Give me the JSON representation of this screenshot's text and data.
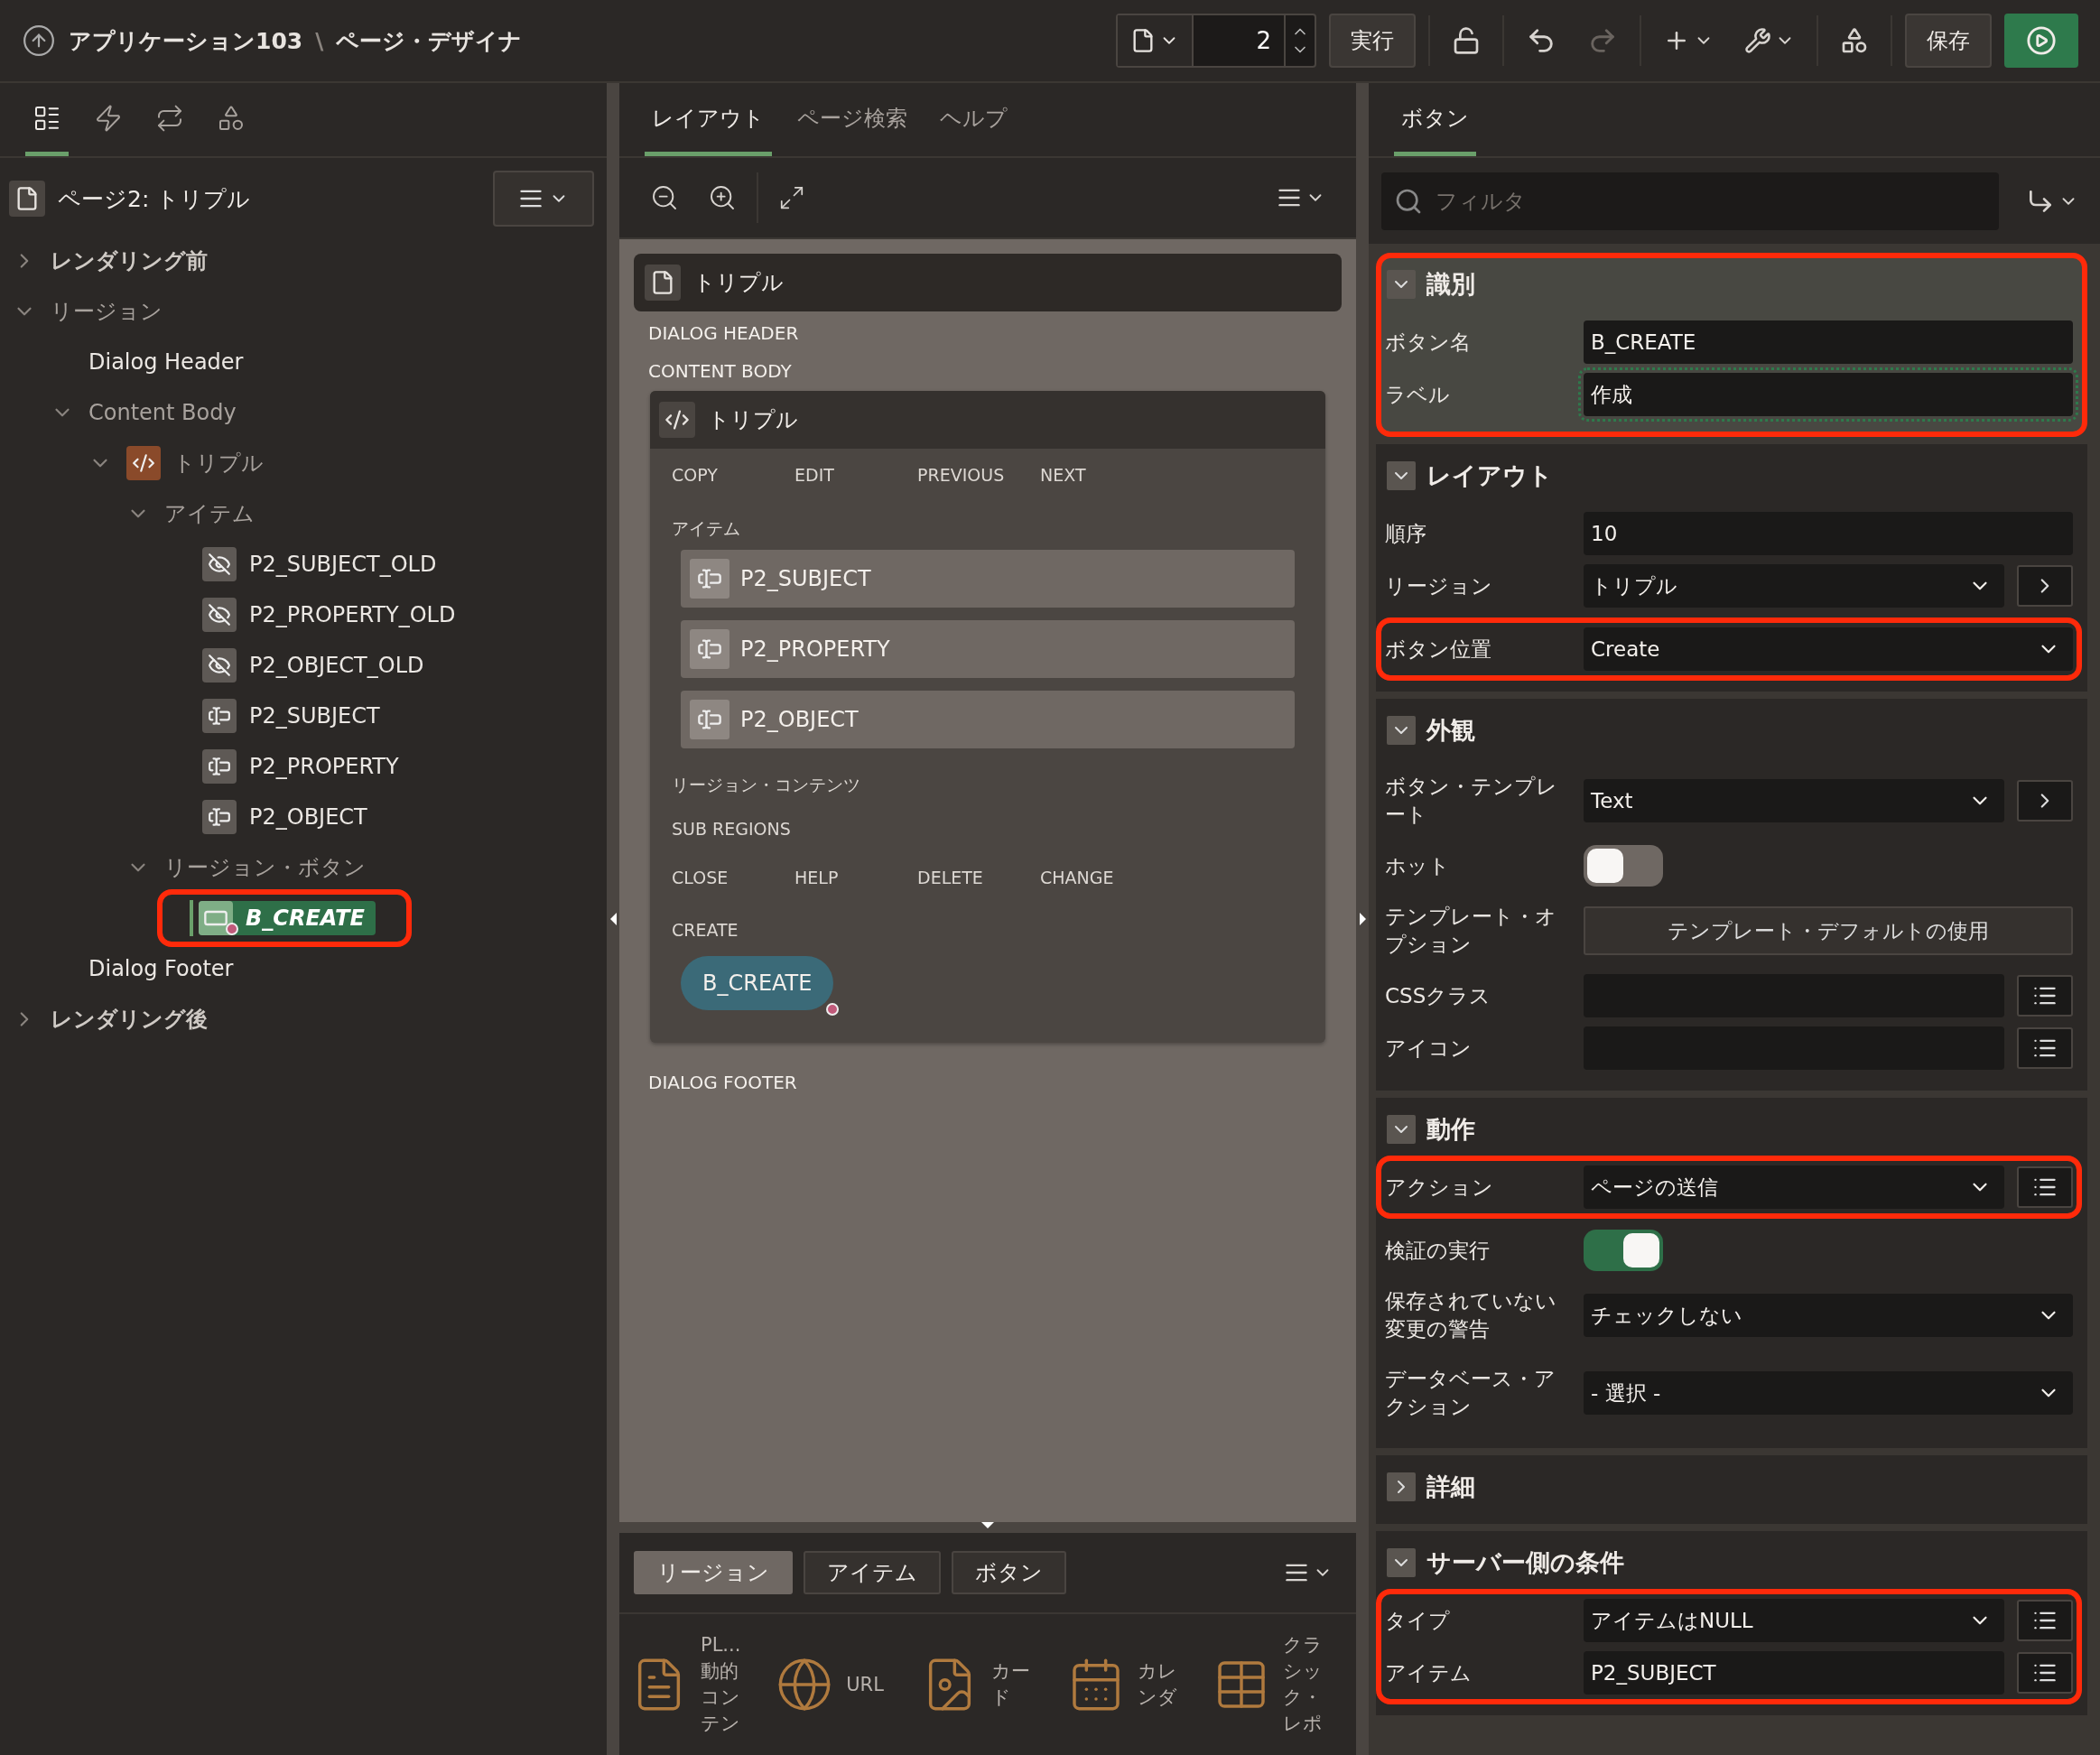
{
  "header": {
    "app": "アプリケーション103",
    "separator": "\\",
    "page_title": "ページ・デザイナ",
    "page_number": "2",
    "run_label": "実行",
    "redo_disabled": true,
    "save_label": "保存"
  },
  "left_tabs": [
    {
      "kind": "tree",
      "selected": true
    },
    {
      "kind": "dynamic",
      "selected": false
    },
    {
      "kind": "process",
      "selected": false
    },
    {
      "kind": "shared",
      "selected": false
    }
  ],
  "tree": {
    "root": "ページ2: トリプル",
    "nodes": [
      {
        "label": "レンダリング前",
        "bold": true,
        "expanded": false
      },
      {
        "label": "リージョン",
        "bold": false,
        "expanded": true,
        "children": [
          {
            "label": "Dialog Header"
          },
          {
            "label": "Content Body",
            "expanded": true,
            "children": [
              {
                "label": "トリプル",
                "kind": "region",
                "expanded": true,
                "children": [
                  {
                    "label": "アイテム",
                    "expanded": true,
                    "children": [
                      {
                        "label": "P2_SUBJECT_OLD",
                        "kind": "hidden"
                      },
                      {
                        "label": "P2_PROPERTY_OLD",
                        "kind": "hidden"
                      },
                      {
                        "label": "P2_OBJECT_OLD",
                        "kind": "hidden"
                      },
                      {
                        "label": "P2_SUBJECT",
                        "kind": "text"
                      },
                      {
                        "label": "P2_PROPERTY",
                        "kind": "text"
                      },
                      {
                        "label": "P2_OBJECT",
                        "kind": "text"
                      }
                    ]
                  },
                  {
                    "label": "リージョン・ボタン",
                    "expanded": true,
                    "children": [
                      {
                        "label": "B_CREATE",
                        "kind": "button",
                        "selected": true,
                        "highlighted": true,
                        "condition": true
                      }
                    ]
                  }
                ]
              }
            ]
          },
          {
            "label": "Dialog Footer"
          }
        ]
      },
      {
        "label": "レンダリング後",
        "bold": true,
        "expanded": false
      }
    ]
  },
  "middle_tabs": [
    {
      "label": "レイアウト",
      "selected": true
    },
    {
      "label": "ページ検索",
      "selected": false
    },
    {
      "label": "ヘルプ",
      "selected": false
    }
  ],
  "canvas": {
    "page": "トリプル",
    "dialog_header": "DIALOG HEADER",
    "content_body": "CONTENT BODY",
    "region": {
      "title": "トリプル",
      "top_positions": [
        "COPY",
        "EDIT",
        "PREVIOUS",
        "NEXT"
      ],
      "items_label": "アイテム",
      "items": [
        "P2_SUBJECT",
        "P2_PROPERTY",
        "P2_OBJECT"
      ],
      "region_content": "リージョン・コンテンツ",
      "sub_regions": "SUB REGIONS",
      "bottom_positions": [
        "CLOSE",
        "HELP",
        "DELETE",
        "CHANGE"
      ],
      "create_label": "CREATE",
      "button": {
        "label": "B_CREATE",
        "condition": true
      }
    },
    "dialog_footer": "DIALOG FOOTER"
  },
  "gallery": {
    "tabs": [
      {
        "label": "リージョン",
        "selected": true
      },
      {
        "label": "アイテム",
        "selected": false
      },
      {
        "label": "ボタン",
        "selected": false
      }
    ],
    "items": [
      {
        "kind": "plsql",
        "label": "PL... 動的コンテン"
      },
      {
        "kind": "url",
        "label": "URL"
      },
      {
        "kind": "card",
        "label": "カード"
      },
      {
        "kind": "calendar",
        "label": "カレンダ"
      },
      {
        "kind": "report",
        "label": "クラシック・レポ"
      }
    ]
  },
  "properties": {
    "tab": "ボタン",
    "filter_placeholder": "フィルタ",
    "sections": [
      {
        "title": "識別",
        "expanded": true,
        "active": true,
        "highlighted": true,
        "rows": [
          {
            "label": "ボタン名",
            "kind": "text",
            "value": "B_CREATE",
            "highlighted": false
          },
          {
            "label": "ラベル",
            "kind": "text",
            "value": "作成",
            "focused": true,
            "highlighted": false
          }
        ]
      },
      {
        "title": "レイアウト",
        "expanded": true,
        "active": false,
        "highlighted": false,
        "rows": [
          {
            "label": "順序",
            "kind": "text",
            "value": "10",
            "highlighted": false
          },
          {
            "label": "リージョン",
            "kind": "select",
            "value": "トリプル",
            "side_button": {
              "kind": "goto"
            },
            "highlighted": false
          },
          {
            "label": "ボタン位置",
            "kind": "select",
            "value": "Create",
            "highlighted": true
          }
        ]
      },
      {
        "title": "外観",
        "expanded": true,
        "active": false,
        "highlighted": false,
        "rows": [
          {
            "label": "ボタン・テンプレート",
            "kind": "select",
            "value": "Text",
            "side_button": {
              "kind": "goto"
            },
            "highlighted": false
          },
          {
            "label": "ホット",
            "kind": "switch",
            "on": false,
            "highlighted": false
          },
          {
            "label": "テンプレート・オプション",
            "kind": "button",
            "value": "テンプレート・デフォルトの使用",
            "highlighted": false
          },
          {
            "label": "CSSクラス",
            "kind": "text",
            "side_button": {
              "kind": "list"
            },
            "highlighted": false
          },
          {
            "label": "アイコン",
            "kind": "text",
            "side_button": {
              "kind": "list"
            },
            "highlighted": false
          }
        ]
      },
      {
        "title": "動作",
        "expanded": true,
        "active": false,
        "highlighted": false,
        "rows": [
          {
            "label": "アクション",
            "kind": "select",
            "value": "ページの送信",
            "side_button": {
              "kind": "list"
            },
            "highlighted": true
          },
          {
            "label": "検証の実行",
            "kind": "switch",
            "on": true,
            "highlighted": false
          },
          {
            "label": "保存されていない変更の警告",
            "kind": "select",
            "value": "チェックしない",
            "highlighted": false
          },
          {
            "label": "データベース・アクション",
            "kind": "select",
            "value": "- 選択 -",
            "highlighted": false
          }
        ]
      },
      {
        "title": "詳細",
        "expanded": false,
        "active": false,
        "highlighted": false
      },
      {
        "title": "サーバー側の条件",
        "expanded": true,
        "active": false,
        "highlighted": false,
        "rows": [
          {
            "label": "タイプ",
            "kind": "select",
            "value": "アイテムはNULL",
            "side_button": {
              "kind": "list"
            },
            "highlighted": true
          },
          {
            "label": "アイテム",
            "kind": "text",
            "value": "P2_SUBJECT",
            "side_button": {
              "kind": "list"
            },
            "highlighted": true
          }
        ]
      }
    ]
  }
}
